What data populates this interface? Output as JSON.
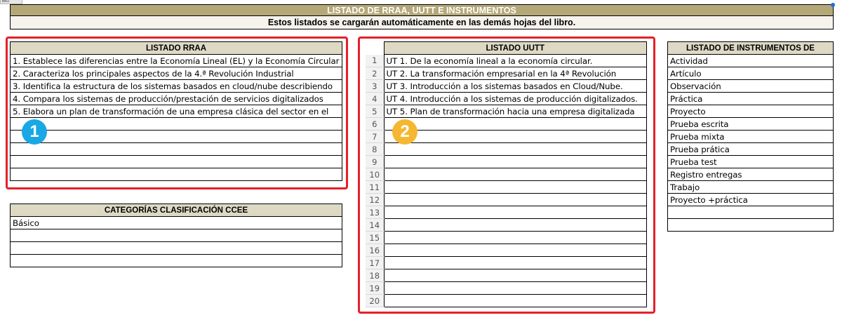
{
  "corner_tag": "Bict",
  "banner": {
    "title": "LISTADO DE RRAA, UUTT E INSTRUMENTOS",
    "subtitle": "Estos listados se cargarán automáticamente en las demás hojas del libro."
  },
  "rraa": {
    "header": "LISTADO RRAA",
    "rows": [
      "1. Establece las diferencias entre la Economía Lineal (EL) y la Economía Circular",
      "2. Caracteriza los principales aspectos de la 4.ª Revolución Industrial",
      "3. Identifica la estructura de los sistemas basados en cloud/nube describiendo",
      "4. Compara los sistemas de producción/prestación de servicios digitalizados",
      "5. Elabora un plan de transformación de una empresa clásica del sector en el",
      "",
      "",
      "",
      "",
      ""
    ]
  },
  "categorias": {
    "header": "CATEGORÍAS CLASIFICACIÓN CCEE",
    "rows": [
      "Básico",
      "",
      "",
      ""
    ]
  },
  "uutt": {
    "header": "LISTADO UUTT",
    "row_numbers": [
      "1",
      "2",
      "3",
      "4",
      "5",
      "6",
      "7",
      "8",
      "9",
      "10",
      "11",
      "12",
      "13",
      "14",
      "15",
      "16",
      "17",
      "18",
      "19",
      "20"
    ],
    "rows": [
      "UT 1. De la economía lineal a la economía circular.",
      "UT 2. La transformación empresarial en la 4ª Revolución",
      "UT 3. Introducción a los sistemas basados en Cloud/Nube.",
      "UT 4. Introducción a los sistemas de producción digitalizados.",
      "UT 5. Plan de transformación hacia una empresa digitalizada",
      "",
      "",
      "",
      "",
      "",
      "",
      "",
      "",
      "",
      "",
      "",
      "",
      "",
      "",
      ""
    ]
  },
  "instrumentos": {
    "header": "LISTADO DE INSTRUMENTOS DE",
    "rows": [
      "Actividad",
      "Artículo",
      "Observación",
      "Práctica",
      "Proyecto",
      "Prueba escrita",
      "Prueba mixta",
      "Prueba prática",
      "Prueba test",
      "Registro entregas",
      "Trabajo",
      "Proyecto +práctica",
      "",
      ""
    ]
  },
  "badges": {
    "one": "1",
    "two": "2"
  },
  "colors": {
    "header_fill": "#ddd9c4",
    "banner_fill": "#b5a878",
    "highlight_border": "#e5202a",
    "badge_1": "#1aa7e6",
    "badge_2": "#f5b731"
  }
}
